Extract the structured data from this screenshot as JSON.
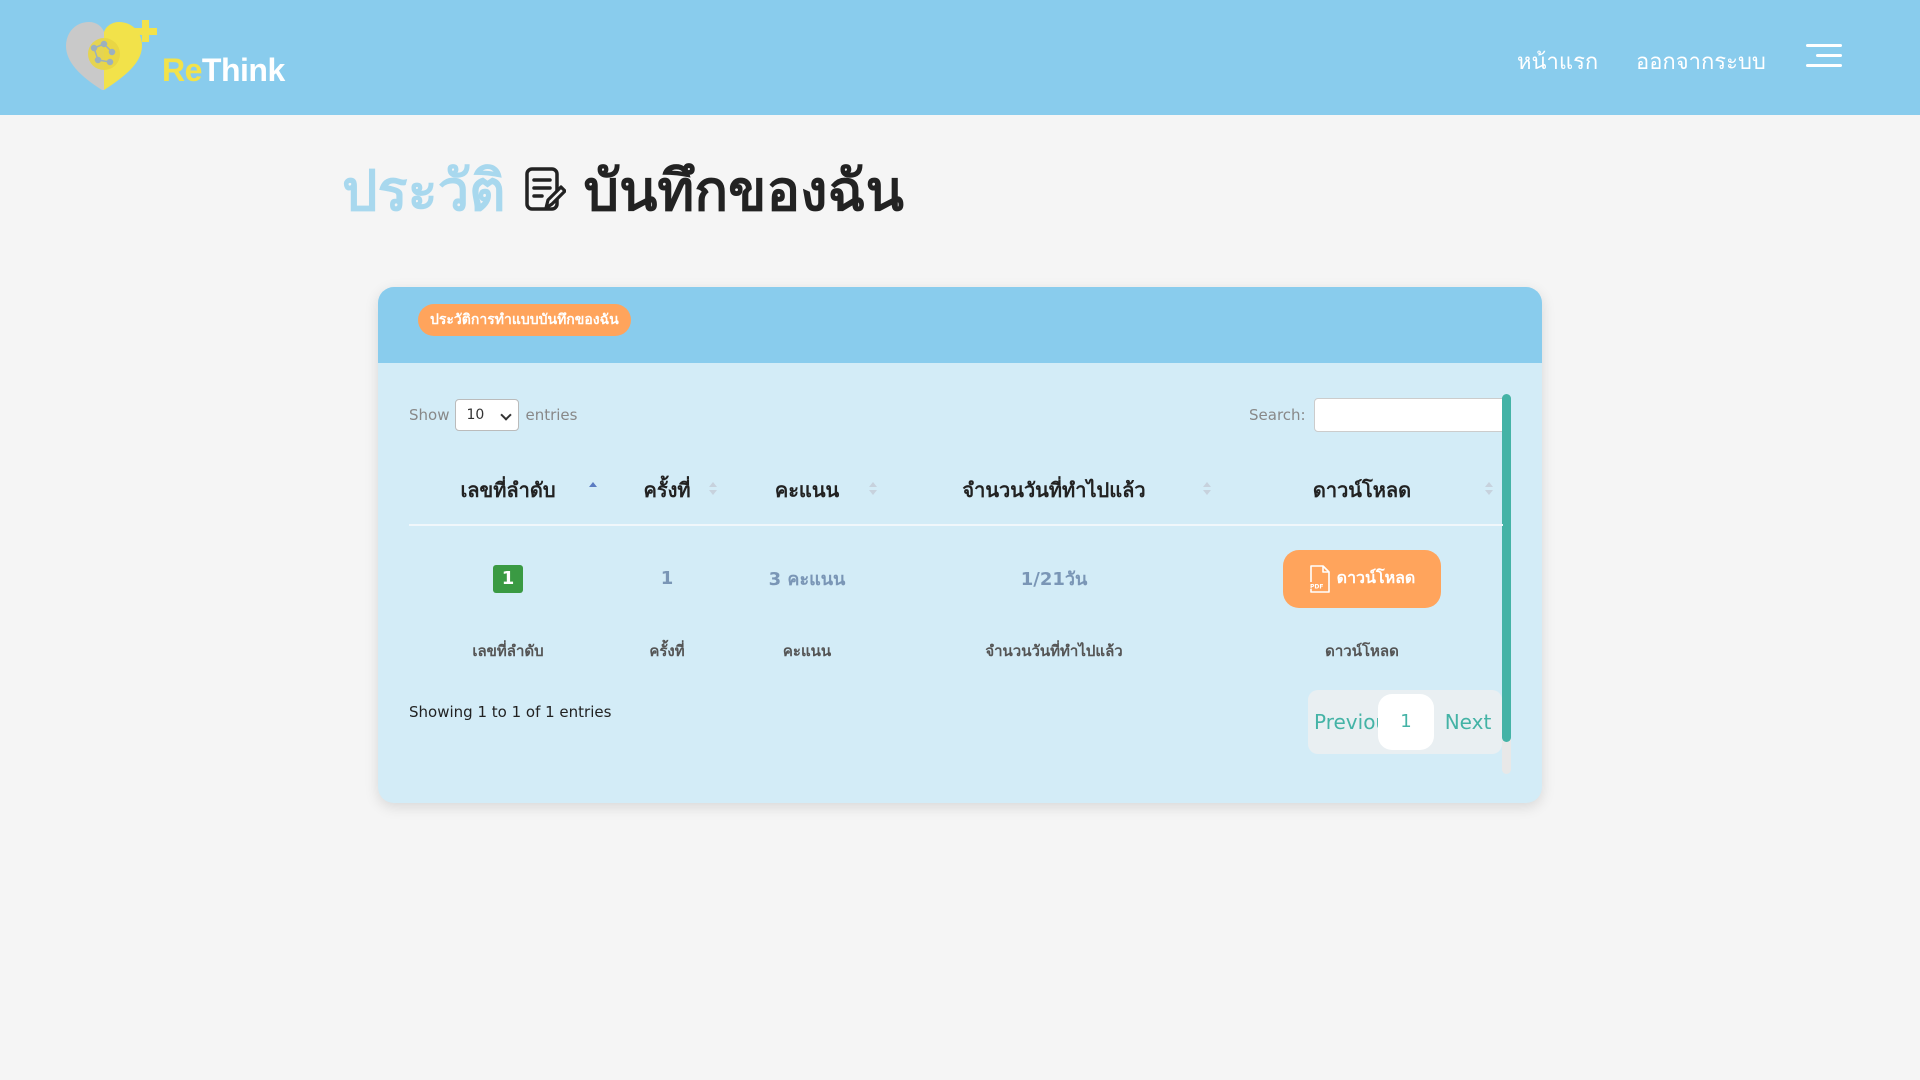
{
  "header": {
    "brand_prefix": "Re",
    "brand_suffix": "Think",
    "nav_home": "หน้าแรก",
    "nav_logout": "ออกจากระบบ",
    "menu_icon": "hamburger-menu-icon"
  },
  "title": {
    "light": "ประวัติ",
    "dark": "บันทึกของฉัน",
    "icon": "note-edit-icon"
  },
  "card": {
    "badge": "ประวัติการทำแบบบันทึกของฉัน",
    "show_label": "Show",
    "entries_label": "entries",
    "page_length": "10",
    "search_label": "Search:",
    "search_value": "",
    "columns": [
      "เลขที่ลำดับ",
      "ครั้งที่",
      "คะแนน",
      "จำนวนวันที่ทำไปแล้ว",
      "ดาวน์โหลด"
    ],
    "rows": [
      {
        "seq": "1",
        "attempt": "1",
        "score": "3 คะแนน",
        "days": "1/21วัน",
        "download": "ดาวน์โหลด"
      }
    ],
    "info": "Showing 1 to 1 of 1 entries",
    "pager": {
      "prev": "Previous",
      "current": "1",
      "next": "Next"
    }
  },
  "colors": {
    "header_bg": "#89cced",
    "card_bg": "#d3ecf7",
    "accent_orange": "#ffa45c",
    "accent_teal": "#44b3a6",
    "badge_green": "#3a9a43"
  }
}
